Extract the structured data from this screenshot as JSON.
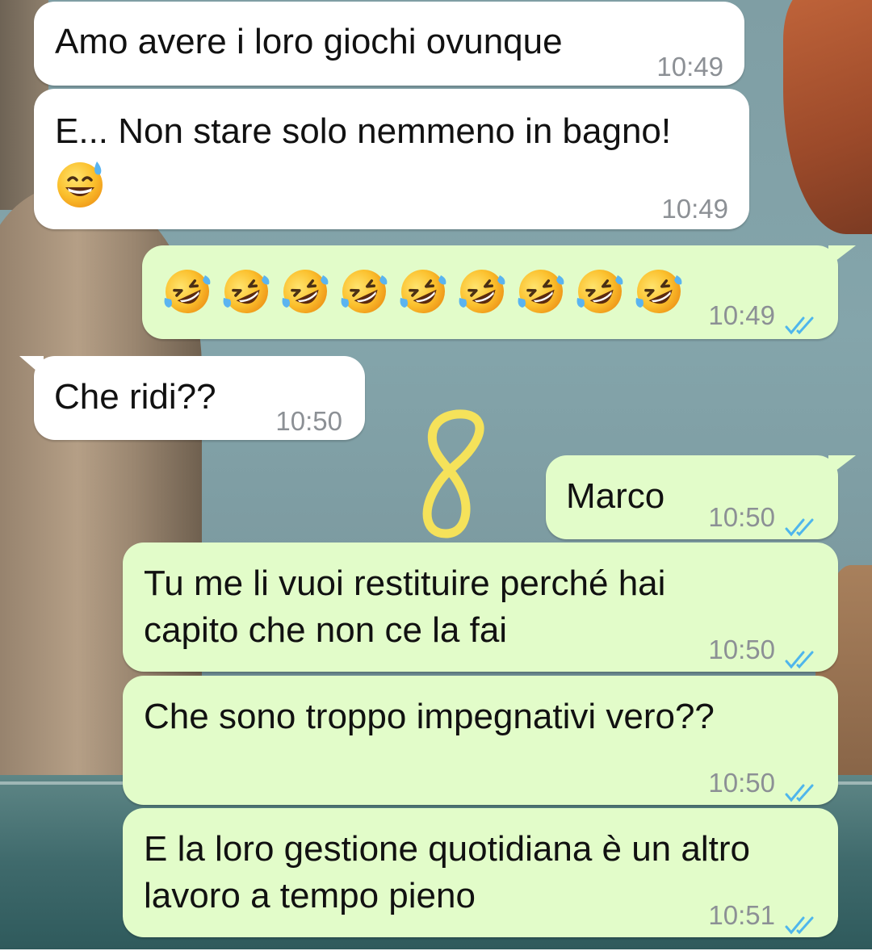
{
  "wallpaper": {
    "description_icon": "sea-rocks-wallpaper"
  },
  "messages": [
    {
      "direction": "in",
      "text": "Amo avere i loro giochi ovunque",
      "time": "10:49"
    },
    {
      "direction": "in",
      "text": "E... Non stare solo nemmeno in bagno!",
      "emoji": "grinning-face-with-sweat",
      "time": "10:49"
    },
    {
      "direction": "out",
      "emoji": "rolling-on-the-floor-laughing",
      "emoji_count": 9,
      "time": "10:49",
      "status": "read-double-check"
    },
    {
      "direction": "in",
      "text": "Che ridi??",
      "time": "10:50"
    },
    {
      "direction": "out",
      "text": "Marco",
      "time": "10:50",
      "status": "read-double-check"
    },
    {
      "direction": "out",
      "text": "Tu me li vuoi restituire perché hai\ncapito che non ce la fai",
      "time": "10:50",
      "status": "read-double-check"
    },
    {
      "direction": "out",
      "text": "Che sono troppo impegnativi vero??",
      "time": "10:50",
      "status": "read-double-check"
    },
    {
      "direction": "out",
      "text": "E la loro gestione quotidiana è un altro\nlavoro a tempo pieno",
      "time": "10:51",
      "status": "read-double-check"
    }
  ],
  "annotation": {
    "handwritten_mark": "8",
    "color": "#f5e25a"
  },
  "colors": {
    "bubble_incoming": "#ffffff",
    "bubble_outgoing": "#e2fcc9",
    "read_tick": "#4fb6ec",
    "meta_text": "#8c9095"
  }
}
